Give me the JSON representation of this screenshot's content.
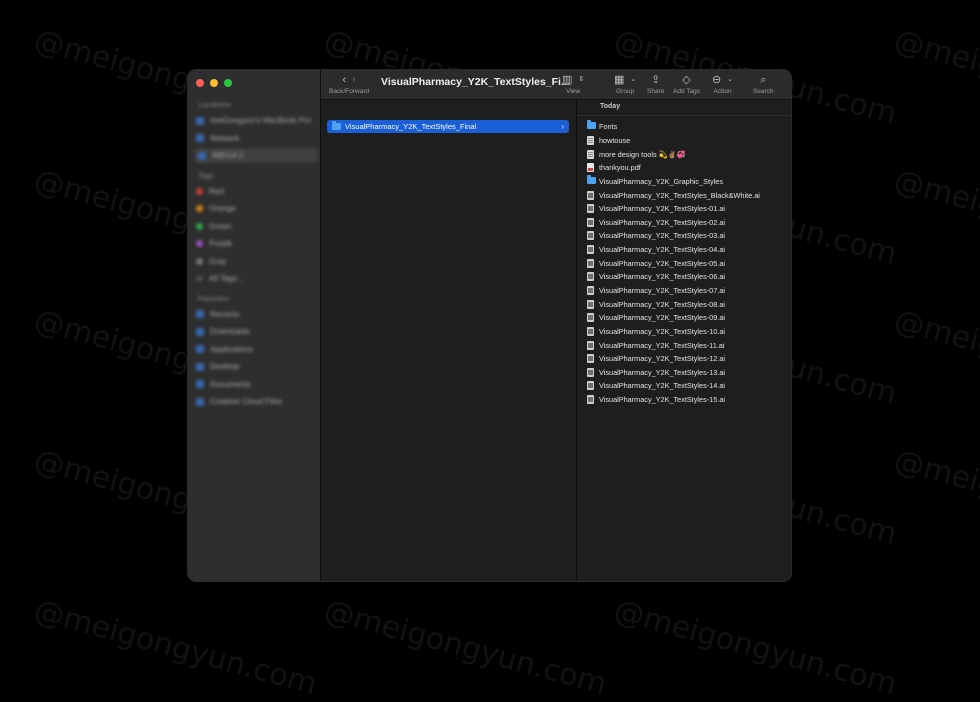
{
  "window": {
    "title": "VisualPharmacy_Y2K_TextStyles_Fi..."
  },
  "toolbar": {
    "back_forward_label": "Back/Forward",
    "view_label": "View",
    "group_label": "Group",
    "share_label": "Share",
    "add_tags_label": "Add Tags",
    "action_label": "Action",
    "search_label": "Search"
  },
  "sidebar": {
    "favorites_header": "Locations",
    "locations": [
      "meiGongyun's MacBook Pro",
      "Network",
      "iMEGA 2"
    ],
    "tags_header": "Tags",
    "tags": [
      {
        "label": "Red",
        "color": "#ff453a"
      },
      {
        "label": "Orange",
        "color": "#ff9f0a"
      },
      {
        "label": "Green",
        "color": "#30d158"
      },
      {
        "label": "Purple",
        "color": "#bf5af2"
      },
      {
        "label": "Gray",
        "color": "#8e8e93"
      },
      {
        "label": "All Tags...",
        "color": "#555555"
      }
    ],
    "favorites_header2": "Favorites",
    "favorites": [
      "Recents",
      "Downloads",
      "Applications",
      "Desktop",
      "Documents",
      "Creative Cloud Files"
    ]
  },
  "column1": {
    "selected_folder": "VisualPharmacy_Y2K_TextStyles_Final"
  },
  "column2": {
    "section_header": "Today",
    "files": [
      {
        "name": "Fonts",
        "type": "folder"
      },
      {
        "name": "howtouse",
        "type": "doc"
      },
      {
        "name": "more design tools 💫✌🏽💞",
        "type": "doc"
      },
      {
        "name": "thankyou.pdf",
        "type": "pdf"
      },
      {
        "name": "VisualPharmacy_Y2K_Graphic_Styles",
        "type": "folder"
      },
      {
        "name": "VisualPharmacy_Y2K_TextStyles_Black&White.ai",
        "type": "ai"
      },
      {
        "name": "VisualPharmacy_Y2K_TextStyles-01.ai",
        "type": "ai"
      },
      {
        "name": "VisualPharmacy_Y2K_TextStyles-02.ai",
        "type": "ai"
      },
      {
        "name": "VisualPharmacy_Y2K_TextStyles-03.ai",
        "type": "ai"
      },
      {
        "name": "VisualPharmacy_Y2K_TextStyles-04.ai",
        "type": "ai"
      },
      {
        "name": "VisualPharmacy_Y2K_TextStyles-05.ai",
        "type": "ai"
      },
      {
        "name": "VisualPharmacy_Y2K_TextStyles-06.ai",
        "type": "ai"
      },
      {
        "name": "VisualPharmacy_Y2K_TextStyles-07.ai",
        "type": "ai"
      },
      {
        "name": "VisualPharmacy_Y2K_TextStyles-08.ai",
        "type": "ai"
      },
      {
        "name": "VisualPharmacy_Y2K_TextStyles-09.ai",
        "type": "ai"
      },
      {
        "name": "VisualPharmacy_Y2K_TextStyles-10.ai",
        "type": "ai"
      },
      {
        "name": "VisualPharmacy_Y2K_TextStyles-11.ai",
        "type": "ai"
      },
      {
        "name": "VisualPharmacy_Y2K_TextStyles-12.ai",
        "type": "ai"
      },
      {
        "name": "VisualPharmacy_Y2K_TextStyles-13.ai",
        "type": "ai"
      },
      {
        "name": "VisualPharmacy_Y2K_TextStyles-14.ai",
        "type": "ai"
      },
      {
        "name": "VisualPharmacy_Y2K_TextStyles-15.ai",
        "type": "ai"
      }
    ]
  },
  "watermark_text": "@meigongyun.com",
  "colors": {
    "selection": "#1a5fd6",
    "folder": "#4ea3f0"
  }
}
